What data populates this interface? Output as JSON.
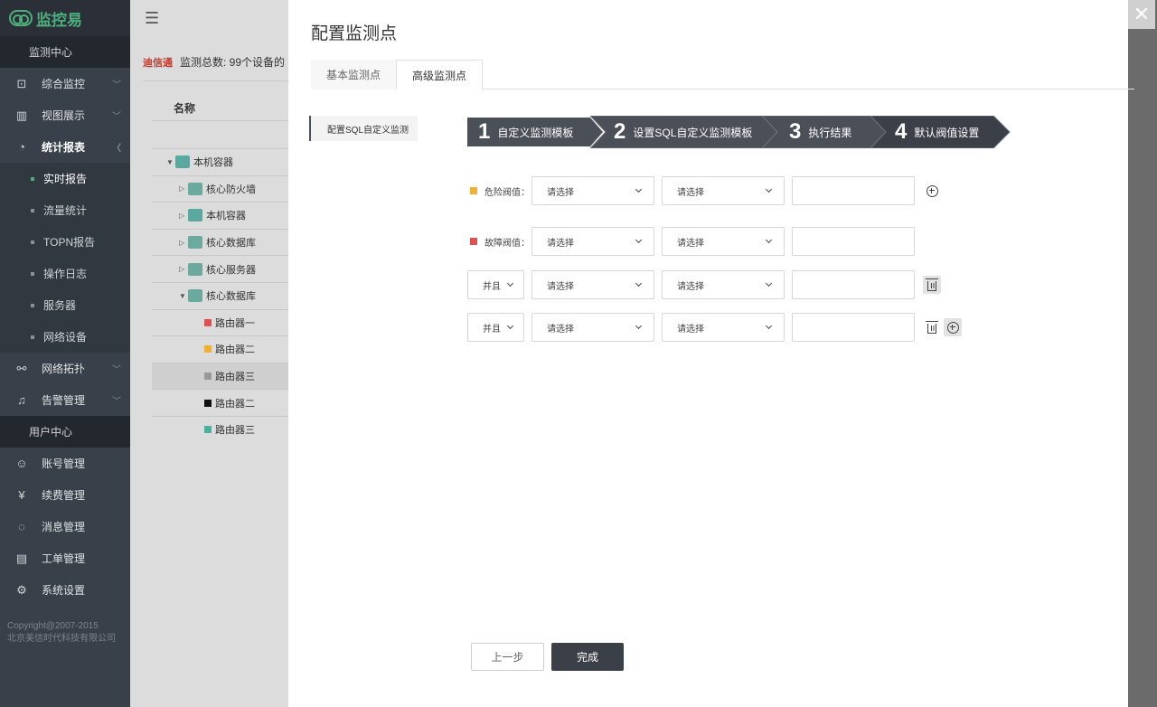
{
  "app": {
    "logo_text": "监控易"
  },
  "sidebar": {
    "section_monitor": "监测中心",
    "items": [
      {
        "label": "综合监控",
        "icon": "monitor-icon"
      },
      {
        "label": "视图展示",
        "icon": "bar-chart-icon"
      },
      {
        "label": "统计报表",
        "icon": "pie-chart-icon"
      }
    ],
    "subitems": [
      {
        "label": "实时报告"
      },
      {
        "label": "流量统计"
      },
      {
        "label": "TOPN报告"
      },
      {
        "label": "操作日志"
      },
      {
        "label": "服务器"
      },
      {
        "label": "网络设备"
      }
    ],
    "items2": [
      {
        "label": "网络拓扑",
        "icon": "topology-icon"
      },
      {
        "label": "告警管理",
        "icon": "bell-icon"
      }
    ],
    "section_user": "用户中心",
    "user_items": [
      {
        "label": "账号管理",
        "icon": "user-icon"
      },
      {
        "label": "续费管理",
        "icon": "yen-icon"
      },
      {
        "label": "消息管理",
        "icon": "chat-icon"
      },
      {
        "label": "工单管理",
        "icon": "clipboard-icon"
      },
      {
        "label": "系统设置",
        "icon": "gear-icon"
      }
    ],
    "copyright_line1": "Copyright@2007-2015",
    "copyright_line2": "北京美信时代科技有限公司"
  },
  "midpanel": {
    "brand": "迪信通",
    "summary": "监测总数: 99个设备的",
    "column_name": "名称",
    "tree": [
      {
        "label": "本机容器",
        "level": 0,
        "toggle": "▼",
        "color": "#5aa9a0"
      },
      {
        "label": "核心防火墙",
        "level": 1,
        "toggle": "▷",
        "color": "#6aaa9f"
      },
      {
        "label": "本机容器",
        "level": 1,
        "toggle": "▷",
        "color": "#5aa9a0"
      },
      {
        "label": "核心数据库",
        "level": 1,
        "toggle": "▷",
        "color": "#6aaa9f"
      },
      {
        "label": "核心服务器",
        "level": 1,
        "toggle": "▷",
        "color": "#6aaa9f"
      },
      {
        "label": "核心数据库",
        "level": 1,
        "toggle": "▼",
        "color": "#6aaa9f"
      },
      {
        "label": "路由器一",
        "level": 2,
        "toggle": "",
        "color": "#e05050"
      },
      {
        "label": "路由器二",
        "level": 2,
        "toggle": "",
        "color": "#f0b030"
      },
      {
        "label": "路由器三",
        "level": 2,
        "toggle": "",
        "color": "#999999"
      },
      {
        "label": "路由器二",
        "level": 2,
        "toggle": "",
        "color": "#111111"
      },
      {
        "label": "路由器三",
        "level": 2,
        "toggle": "",
        "color": "#4ab0a0"
      }
    ]
  },
  "modal": {
    "title": "配置监测点",
    "tabs": [
      "基本监测点",
      "高级监测点"
    ],
    "left_nav": "配置SQL自定义监测",
    "steps": [
      {
        "num": "1",
        "label": "自定义监测模板"
      },
      {
        "num": "2",
        "label": "设置SQL自定义监测模板"
      },
      {
        "num": "3",
        "label": "执行结果"
      },
      {
        "num": "4",
        "label": "默认阀值设置"
      }
    ],
    "danger_label": "危险阀值：",
    "danger_color": "#f0b030",
    "fault_label": "故障阀值：",
    "fault_color": "#e05050",
    "and_label": "并且",
    "select_placeholder": "请选择",
    "prev_button": "上一步",
    "done_button": "完成"
  }
}
